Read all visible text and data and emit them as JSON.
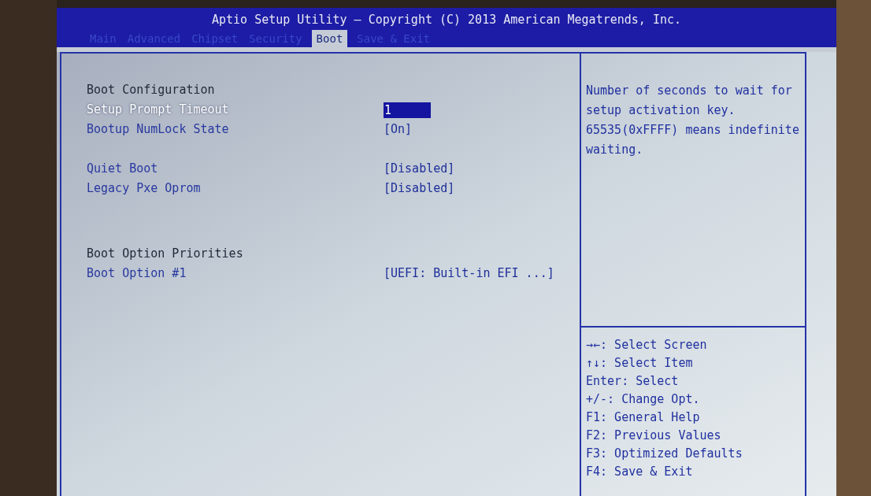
{
  "window": {
    "title": "Aptio Setup Utility – Copyright (C) 2013 American Megatrends, Inc."
  },
  "tabs": [
    {
      "label": "Main",
      "selected": false
    },
    {
      "label": "Advanced",
      "selected": false
    },
    {
      "label": "Chipset",
      "selected": false
    },
    {
      "label": "Security",
      "selected": false
    },
    {
      "label": "Boot",
      "selected": true
    },
    {
      "label": "Save & Exit",
      "selected": false
    }
  ],
  "groups": [
    [
      {
        "kind": "header",
        "label": "Boot Configuration"
      },
      {
        "kind": "setting",
        "label": "Setup Prompt Timeout",
        "value": "1",
        "selected": true
      },
      {
        "kind": "setting",
        "label": "Bootup NumLock State",
        "value": "[On]",
        "selected": false
      }
    ],
    [
      {
        "kind": "setting",
        "label": "Quiet Boot",
        "value": "[Disabled]",
        "selected": false
      },
      {
        "kind": "setting",
        "label": "Legacy Pxe Oprom",
        "value": "[Disabled]",
        "selected": false
      }
    ],
    [
      {
        "kind": "header",
        "label": "Boot Option Priorities"
      },
      {
        "kind": "setting",
        "label": "Boot Option #1",
        "value": "[UEFI: Built-in EFI ...]",
        "selected": false
      }
    ]
  ],
  "help_text": [
    "Number of seconds to wait for",
    "setup activation key.",
    "65535(0xFFFF) means indefinite",
    "waiting."
  ],
  "keys": [
    "→←: Select Screen",
    "↑↓: Select Item",
    "Enter: Select",
    "+/-: Change Opt.",
    "F1: General Help",
    "F2: Previous Values",
    "F3: Optimized Defaults",
    "F4: Save & Exit"
  ]
}
